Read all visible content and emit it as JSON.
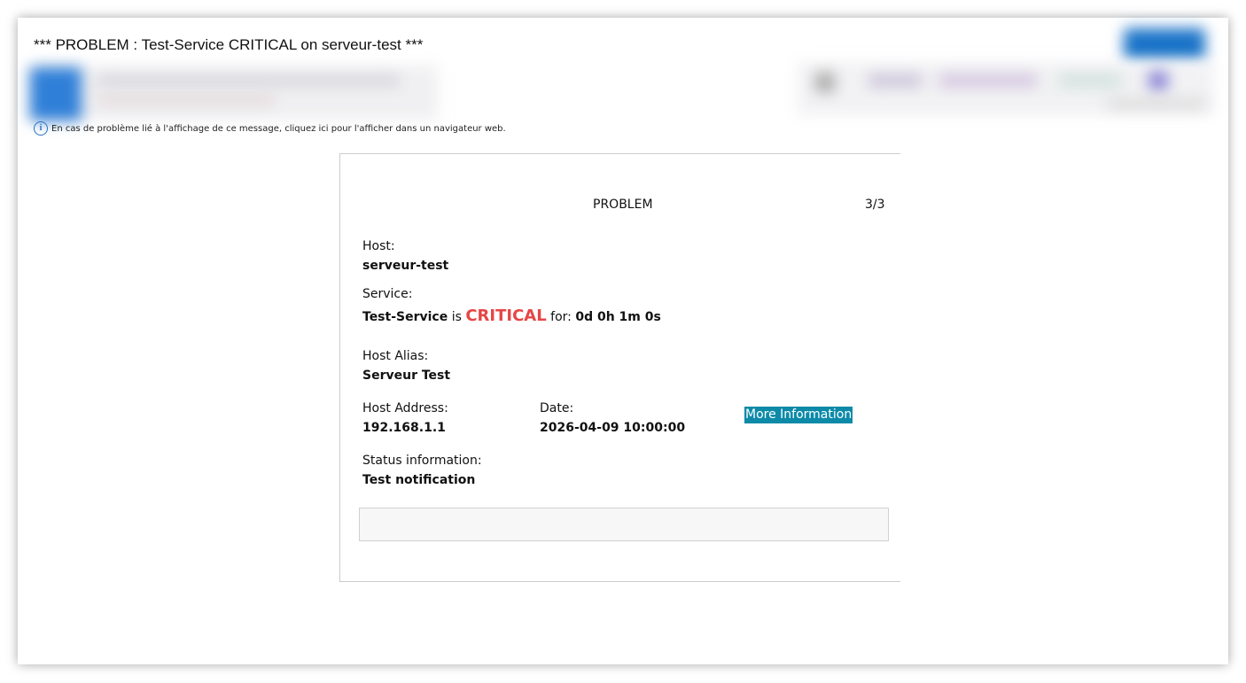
{
  "email": {
    "subject": "*** PROBLEM : Test-Service CRITICAL on serveur-test ***",
    "info_message": "En cas de problème lié à l'affichage de ce message, cliquez ici pour l'afficher dans un navigateur web.",
    "info_icon": "info-icon"
  },
  "notification": {
    "type": "PROBLEM",
    "counter": "3/3",
    "host_label": "Host:",
    "host_value": "serveur-test",
    "service_label": "Service:",
    "service_name": "Test-Service",
    "is_text": "is",
    "state": "CRITICAL",
    "state_color": "#e64646",
    "for_text": "for:",
    "duration": "0d 0h 1m 0s",
    "host_alias_label": "Host Alias:",
    "host_alias_value": "Serveur Test",
    "host_address_label": "Host Address:",
    "host_address_value": "192.168.1.1",
    "date_label": "Date:",
    "date_value": "2026-04-09 10:00:00",
    "more_info_label": "More Information",
    "more_info_color": "#0d8aa8",
    "status_info_label": "Status information:",
    "status_info_value": "Test notification"
  }
}
